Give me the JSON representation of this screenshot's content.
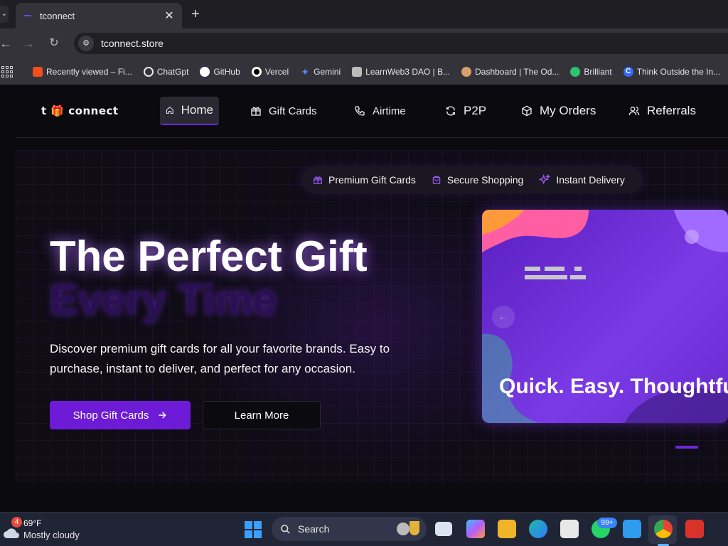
{
  "browser": {
    "tab_title": "tconnect",
    "url": "tconnect.store",
    "bookmarks": [
      {
        "label": "Recently viewed – Fi...",
        "icon": "figma-icon",
        "color": "#f24e1e"
      },
      {
        "label": "ChatGpt",
        "icon": "chatgpt-icon",
        "color": "#e8e8e8"
      },
      {
        "label": "GitHub",
        "icon": "github-icon",
        "color": "#ffffff"
      },
      {
        "label": "Vercel",
        "icon": "vercel-icon",
        "color": "#ffffff"
      },
      {
        "label": "Gemini",
        "icon": "gemini-icon",
        "color": "#4f8dff"
      },
      {
        "label": "LearnWeb3 DAO | B...",
        "icon": "learnweb3-icon",
        "color": "#cfcfcf"
      },
      {
        "label": "Dashboard | The Od...",
        "icon": "odin-icon",
        "color": "#d8a06a"
      },
      {
        "label": "Brilliant",
        "icon": "brilliant-icon",
        "color": "#2fc26c"
      },
      {
        "label": "Think Outside the In...",
        "icon": "c-icon",
        "color": "#2f6bff"
      }
    ]
  },
  "site": {
    "brand": "t 🎁 connect",
    "nav": [
      {
        "label": "Home",
        "icon": "home-icon"
      },
      {
        "label": "Gift Cards",
        "icon": "gift-icon"
      },
      {
        "label": "Airtime",
        "icon": "phone-icon"
      },
      {
        "label": "P2P",
        "icon": "refresh-icon"
      },
      {
        "label": "My Orders",
        "icon": "box-icon"
      },
      {
        "label": "Referrals",
        "icon": "users-icon"
      }
    ],
    "pills": [
      {
        "label": "Premium Gift Cards",
        "icon": "gift-icon"
      },
      {
        "label": "Secure Shopping",
        "icon": "shopping-bag-icon"
      },
      {
        "label": "Instant Delivery",
        "icon": "sparkles-icon"
      }
    ],
    "hero": {
      "title_line1": "The Perfect Gift",
      "title_line2": "Every Time",
      "description": "Discover premium gift cards for all your favorite brands. Easy to purchase, instant to deliver, and perfect for any occasion.",
      "primary_button": "Shop Gift Cards",
      "secondary_button": "Learn More",
      "card_caption": "Quick. Easy. Thoughtful."
    },
    "accent_color": "#6d1bd6"
  },
  "taskbar": {
    "weather_badge": "4",
    "weather_temp": "69°F",
    "weather_desc": "Mostly cloudy",
    "search_label": "Search",
    "whatsapp_badge": "99+"
  }
}
